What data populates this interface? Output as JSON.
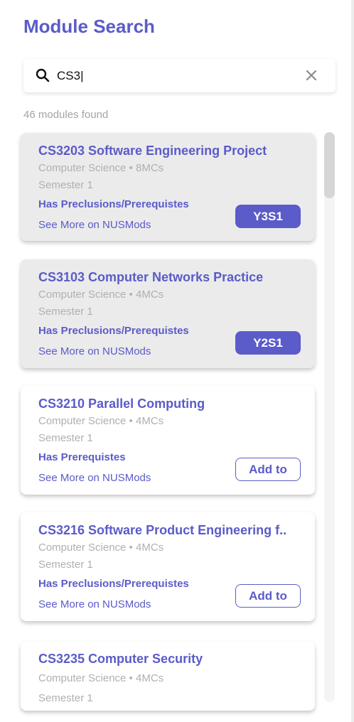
{
  "title": "Module Search",
  "search": {
    "value": "CS3|"
  },
  "results_count": "46 modules found",
  "modules": [
    {
      "title": "CS3203 Software Engineering Project",
      "meta": "Computer Science • 8MCs",
      "semester": "Semester 1",
      "prereq": "Has Preclusions/Prerequistes",
      "link": "See More on NUSMods",
      "action": "Y3S1"
    },
    {
      "title": "CS3103 Computer Networks Practice",
      "meta": "Computer Science • 4MCs",
      "semester": "Semester 1",
      "prereq": "Has Preclusions/Prerequistes",
      "link": "See More on NUSMods",
      "action": "Y2S1"
    },
    {
      "title": "CS3210 Parallel Computing",
      "meta": "Computer Science • 4MCs",
      "semester": "Semester 1",
      "prereq": "Has Prerequistes",
      "link": "See More on NUSMods",
      "action": "Add to"
    },
    {
      "title": "CS3216 Software Product Engineering f..",
      "meta": "Computer Science • 4MCs",
      "semester": "Semester 1",
      "prereq": "Has Preclusions/Prerequistes",
      "link": "See More on NUSMods",
      "action": "Add to"
    },
    {
      "title": "CS3235 Computer Security",
      "meta": "Computer Science • 4MCs",
      "semester": "Semester 1"
    }
  ],
  "colors": {
    "accent": "#5b5bc9",
    "muted": "#b0b0b0",
    "added_card_bg": "#ebebeb"
  },
  "icons": {
    "search": "search-icon",
    "clear": "close-icon"
  }
}
